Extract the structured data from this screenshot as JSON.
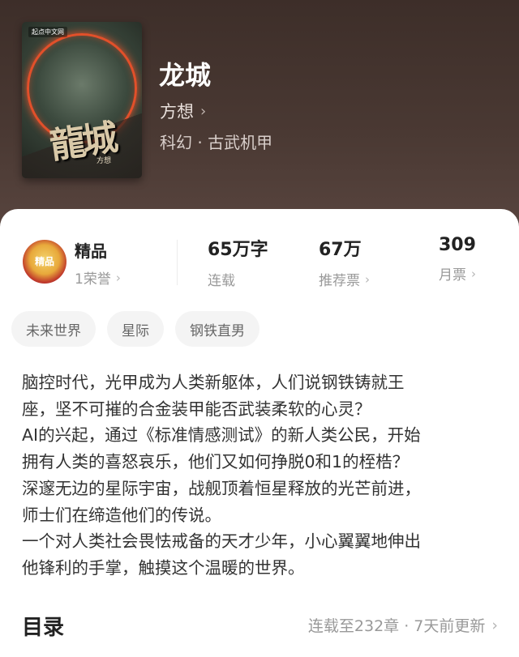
{
  "book": {
    "cover_publisher": "起点中文网",
    "cover_title": "龍城",
    "cover_author": "方想",
    "title": "龙城",
    "author": "方想",
    "genre": "科幻 · 古武机甲"
  },
  "stats": {
    "badge_text": "精品",
    "quality_label": "精品",
    "honor_label": "1荣誉",
    "word_count": "65万字",
    "word_count_label": "连载",
    "recommend_value": "67万",
    "recommend_label": "推荐票",
    "monthly_value": "309",
    "monthly_label": "月票"
  },
  "tags": [
    "未来世界",
    "星际",
    "钢铁直男"
  ],
  "description": [
    "脑控时代，光甲成为人类新躯体，人们说钢铁铸就王",
    "座，坚不可摧的合金装甲能否武装柔软的心灵？",
    "AI的兴起，通过《标准情感测试》的新人类公民，开始",
    "拥有人类的喜怒哀乐，他们又如何挣脱0和1的桎梏？",
    "深邃无边的星际宇宙，战舰顶着恒星释放的光芒前进，",
    "师士们在缔造他们的传说。",
    "一个对人类社会畏怯戒备的天才少年，小心翼翼地伸出",
    "他锋利的手掌，触摸这个温暖的世界。"
  ],
  "toc": {
    "title": "目录",
    "status": "连载至232章 · 7天前更新"
  },
  "icons": {
    "chevron": "chevron-right-icon"
  },
  "colors": {
    "header_bg": "#4a3933",
    "muted_text": "#999999",
    "tag_bg": "#f4f4f4"
  }
}
